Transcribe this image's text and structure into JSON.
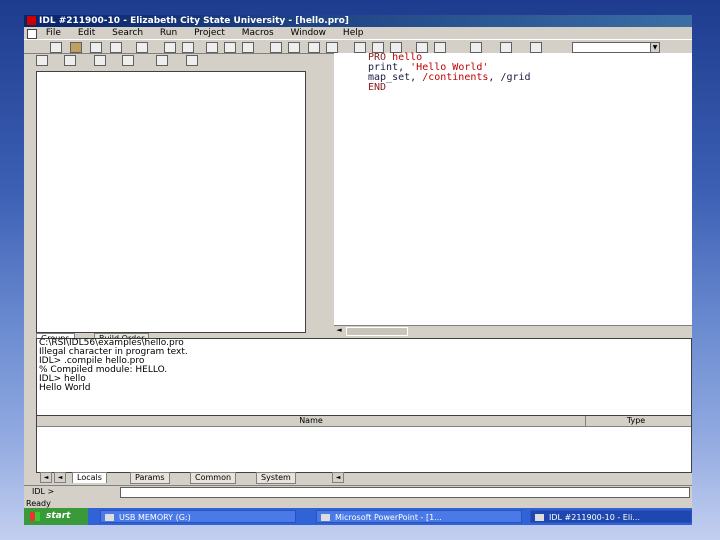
{
  "window": {
    "title": "IDL #211900-10 - Elizabeth City State University - [hello.pro]"
  },
  "menu": [
    "File",
    "Edit",
    "Search",
    "Run",
    "Project",
    "Macros",
    "Window",
    "Help"
  ],
  "left_tabs": [
    "Groups",
    "Build Order"
  ],
  "editor": {
    "lines": [
      {
        "kw": "PRO ",
        "id": "hello",
        "rest": ""
      },
      {
        "kw": "print, ",
        "str": "'Hello World'",
        "rest": ""
      },
      {
        "kw": "map_set, ",
        "str": "/continents",
        "rest": ", /grid"
      },
      {
        "kw": "END",
        "str": "",
        "rest": ""
      }
    ]
  },
  "console": {
    "lines": [
      "C:\\RSI\\IDL56\\examples\\hello.pro",
      "",
      "Illegal character in program text.",
      "IDL> .compile hello.pro",
      "% Compiled module: HELLO.",
      "IDL> hello",
      "Hello World"
    ]
  },
  "variables": {
    "columns": [
      "Name",
      "Type"
    ]
  },
  "variable_tabs": [
    "Locals",
    "Params",
    "Common",
    "System"
  ],
  "command": {
    "label": "IDL >",
    "value": ""
  },
  "status": "Ready",
  "taskbar": {
    "start": "start",
    "tasks": [
      "USB MEMORY (G:)",
      "Microsoft PowerPoint - [1...",
      "IDL #211900-10 - Eli..."
    ]
  }
}
